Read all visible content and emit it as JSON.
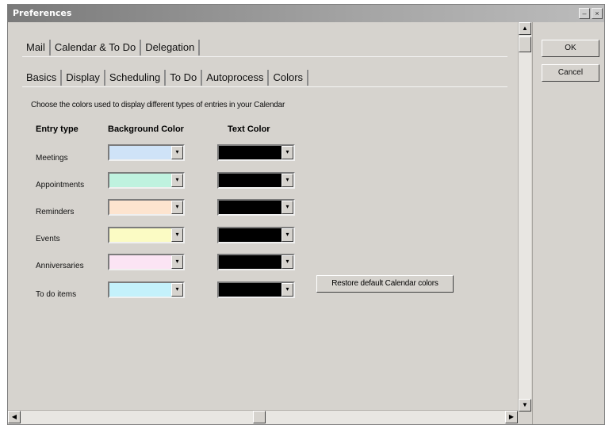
{
  "window": {
    "title": "Preferences",
    "minimize_glyph": "–",
    "close_glyph": "×"
  },
  "top_tabs": [
    {
      "label": "Mail"
    },
    {
      "label": "Calendar & To Do"
    },
    {
      "label": "Delegation"
    }
  ],
  "sub_tabs": [
    {
      "label": "Basics"
    },
    {
      "label": "Display"
    },
    {
      "label": "Scheduling"
    },
    {
      "label": "To Do"
    },
    {
      "label": "Autoprocess"
    },
    {
      "label": "Colors"
    }
  ],
  "active_top_tab": "Calendar & To Do",
  "active_sub_tab": "Colors",
  "prompt": "Choose the colors used to display different types of entries in your Calendar",
  "headers": {
    "entry_type": "Entry type",
    "background_color": "Background Color",
    "text_color": "Text  Color"
  },
  "entries": [
    {
      "label": "Meetings",
      "background": "#cfe3f7",
      "text": "#000000"
    },
    {
      "label": "Appointments",
      "background": "#bff2df",
      "text": "#000000"
    },
    {
      "label": "Reminders",
      "background": "#fde4cf",
      "text": "#000000"
    },
    {
      "label": "Events",
      "background": "#fbfbc4",
      "text": "#000000"
    },
    {
      "label": "Anniversaries",
      "background": "#fbe4f4",
      "text": "#000000"
    },
    {
      "label": "To do items",
      "background": "#c4f1fb",
      "text": "#000000"
    }
  ],
  "restore_button": "Restore default Calendar colors",
  "ok_button": "OK",
  "cancel_button": "Cancel",
  "icons": {
    "dropdown_arrow": "▾",
    "scroll_up": "▲",
    "scroll_down": "▼",
    "scroll_left": "◀",
    "scroll_right": "▶"
  }
}
